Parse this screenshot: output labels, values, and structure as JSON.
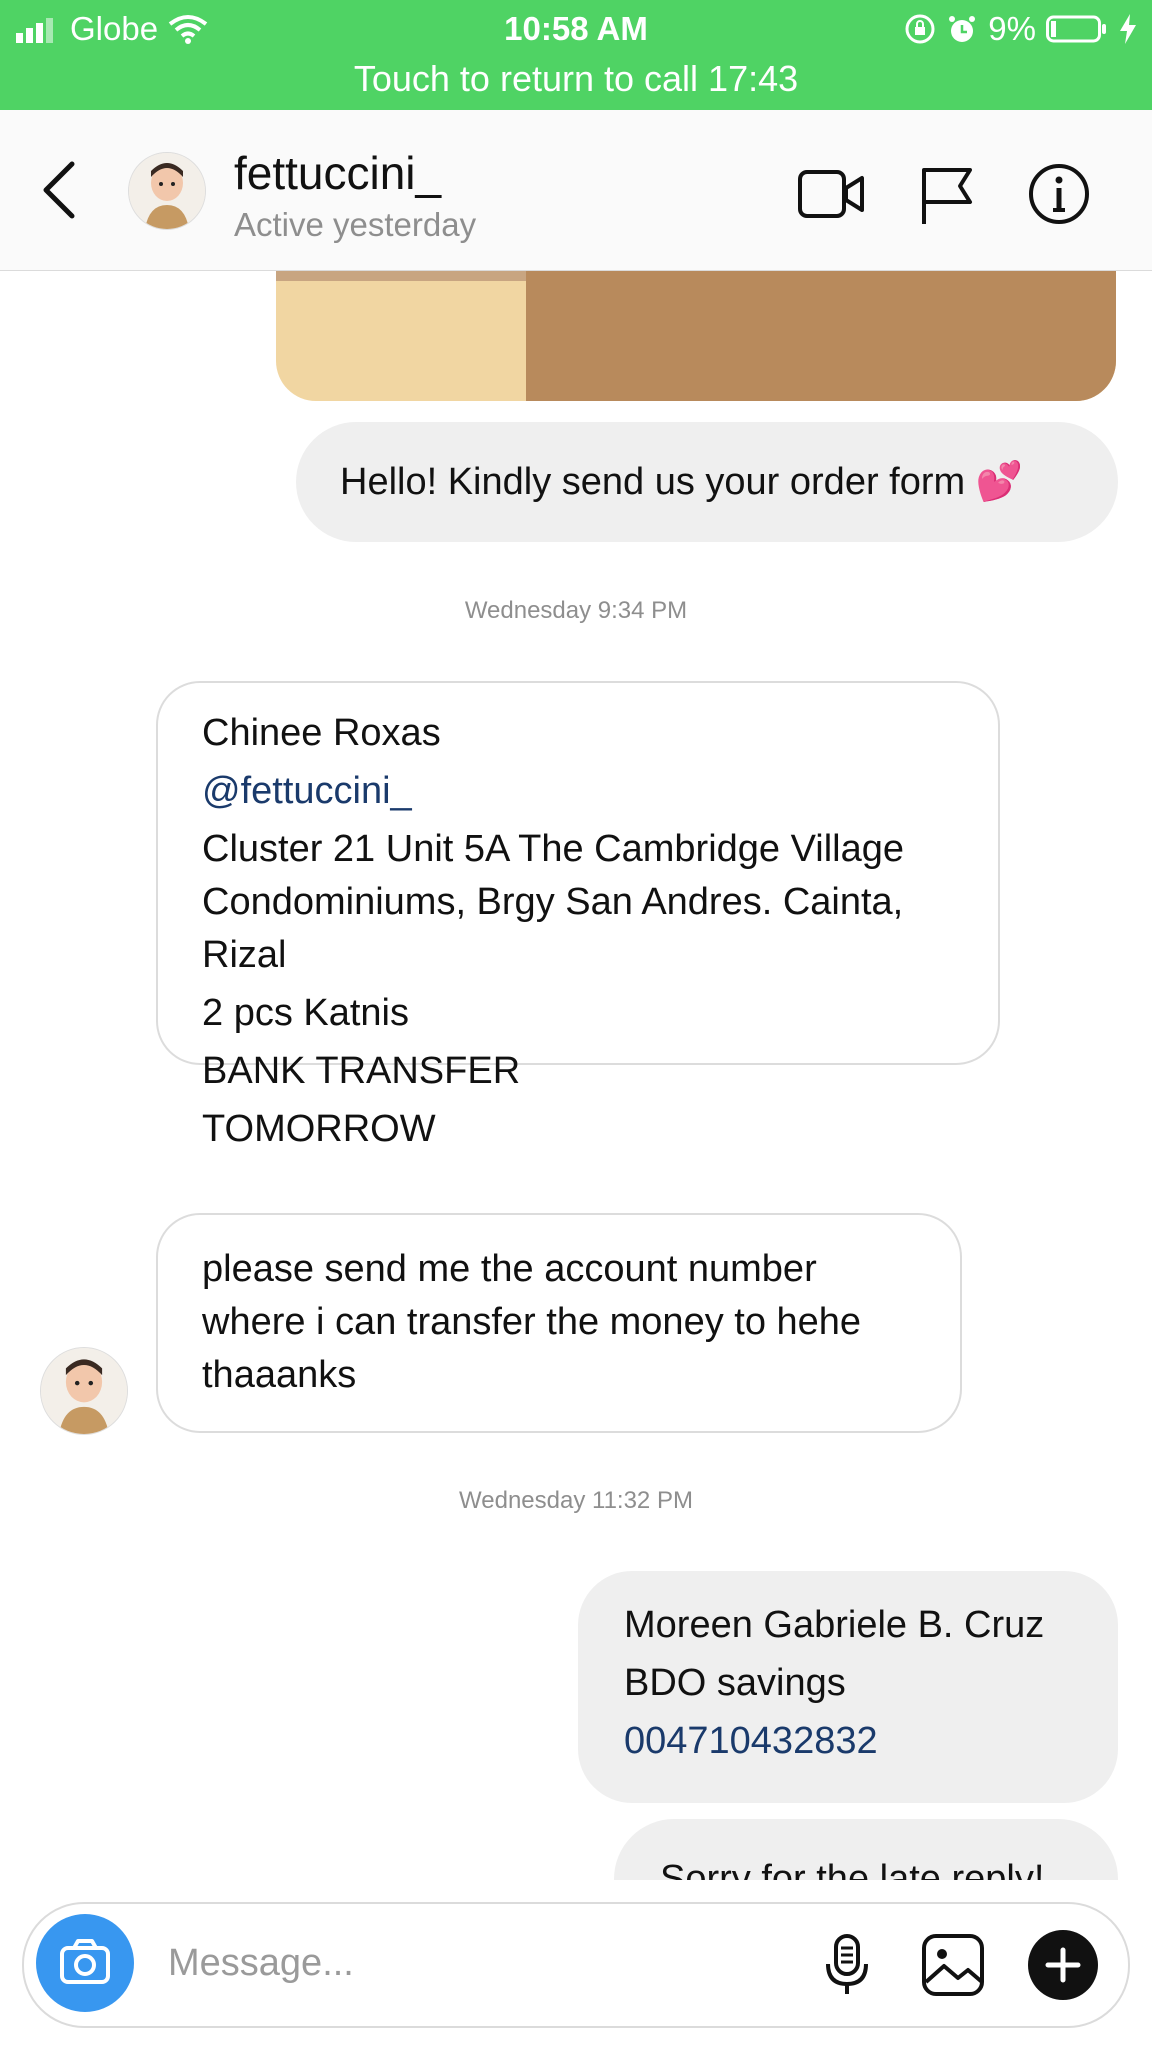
{
  "status_bar": {
    "carrier": "Globe",
    "time": "10:58 AM",
    "battery": "9%",
    "call_banner": "Touch to return to call 17:43"
  },
  "header": {
    "username": "fettuccini_",
    "status": "Active yesterday"
  },
  "messages": {
    "m1": "Hello! Kindly send us your order form 💕",
    "ts1": "Wednesday 9:34 PM",
    "m2": {
      "l1": "Chinee Roxas",
      "l2": "@fettuccini_",
      "l3": "Cluster 21 Unit 5A The Cambridge Village",
      "l4": "Condominiums, Brgy San Andres. Cainta,",
      "l5": "Rizal",
      "l6": "2 pcs Katnis",
      "l7": "BANK TRANSFER",
      "l8": "TOMORROW"
    },
    "m3": {
      "l1": "please send me the account number",
      "l2": "where i can transfer the money to hehe",
      "l3": "thaaanks"
    },
    "ts2": "Wednesday 11:32 PM",
    "m4": {
      "l1": "Moreen Gabriele B. Cruz",
      "l2": "BDO savings",
      "l3": "004710432832"
    },
    "m5": "Sorry for the late reply!"
  },
  "composer": {
    "placeholder": "Message..."
  },
  "colors": {
    "status_bar_bg": "#4fd364",
    "outgoing_bubble": "#efefef",
    "link": "#1a3a6b",
    "camera_button": "#3897f0"
  }
}
